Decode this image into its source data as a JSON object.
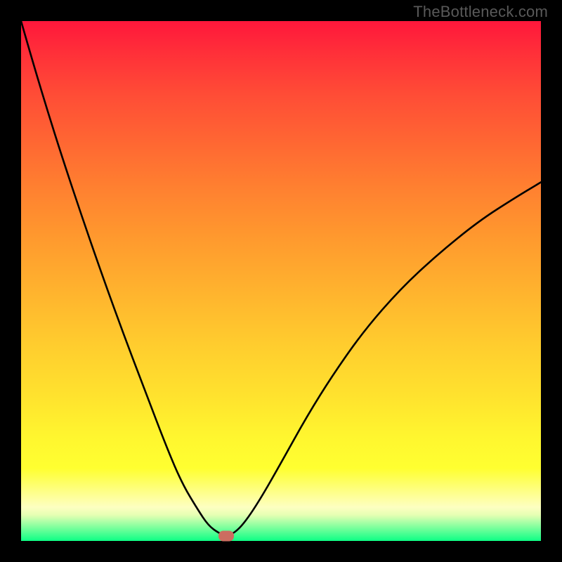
{
  "watermark": "TheBottleneck.com",
  "chart_data": {
    "type": "line",
    "title": "",
    "xlabel": "",
    "ylabel": "",
    "xlim": [
      0,
      100
    ],
    "ylim": [
      0,
      100
    ],
    "grid": false,
    "background_gradient": {
      "top": "#ff173b",
      "middle": "#ffe22e",
      "bottom": "#0dff85"
    },
    "series": [
      {
        "name": "bottleneck-curve",
        "color": "#000000",
        "x": [
          0,
          2,
          5,
          8,
          12,
          16,
          20,
          24,
          28,
          31,
          34,
          36,
          38,
          39.5,
          41,
          43,
          46,
          50,
          55,
          60,
          66,
          73,
          80,
          88,
          95,
          100
        ],
        "y": [
          100,
          93,
          83,
          73.5,
          61.5,
          50,
          39,
          28.5,
          18,
          11,
          6,
          3,
          1.5,
          1,
          1.5,
          3.5,
          8,
          15,
          24,
          32,
          40.5,
          48.5,
          55,
          61.5,
          66,
          69
        ]
      }
    ],
    "marker": {
      "name": "optimal-point",
      "x": 39.5,
      "y": 1,
      "color": "#cc6d60"
    }
  }
}
